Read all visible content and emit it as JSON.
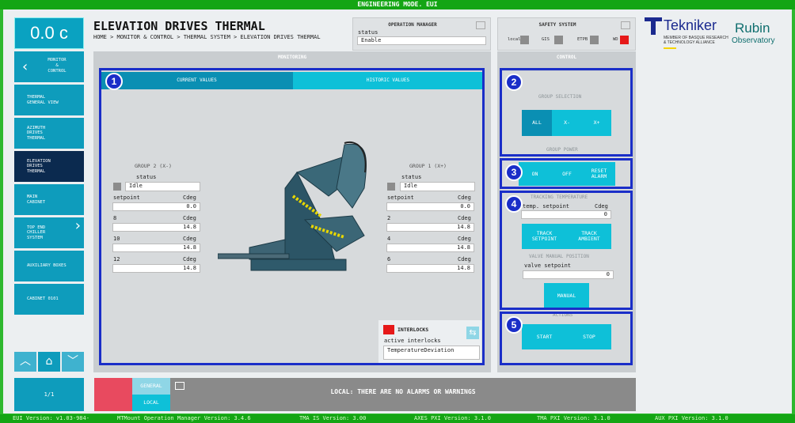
{
  "topbar": {
    "title": "ENGINEERING MODE. EUI"
  },
  "temperature": {
    "value": "0.0 c"
  },
  "nav": {
    "monitor_control": "MONITOR\n&\nCONTROL",
    "items": [
      "THERMAL\nGENERAL VIEW",
      "AZIMUTH\nDRIVES\nTHERMAL",
      "ELEVATION\nDRIVES\nTHERMAL",
      "MAIN\nCABINET",
      "TOP END\nCHILLER\nSYSTEM",
      "AUXILIARY BOXES",
      "CABINET 0101"
    ],
    "page_counter": "1/1"
  },
  "header": {
    "title": "ELEVATION DRIVES THERMAL",
    "breadcrumb": "HOME > MONITOR & CONTROL > THERMAL SYSTEM > ELEVATION DRIVES THERMAL"
  },
  "operation_manager": {
    "title": "OPERATION MANAGER",
    "status_label": "status",
    "status_value": "Enable"
  },
  "safety_system": {
    "title": "SAFETY SYSTEM",
    "indicators": [
      {
        "label": "local",
        "color": "#8c8c8c"
      },
      {
        "label": "GIS",
        "color": "#8c8c8c"
      },
      {
        "label": "ETPB",
        "color": "#8c8c8c"
      },
      {
        "label": "WD",
        "color": "#e61919"
      }
    ]
  },
  "logos": {
    "tekniker": "Tekniker",
    "tekniker_sub": "MEMBER OF BASQUE RESEARCH\n& TECHNOLOGY ALLIANCE",
    "rubin": "Rubin",
    "observatory": "Observatory"
  },
  "monitoring": {
    "title": "MONITORING",
    "tabs": [
      "CURRENT VALUES",
      "HISTORIC VALUES"
    ],
    "group2": {
      "title": "GROUP 2 (X-)",
      "status_label": "status",
      "status_value": "Idle",
      "rows": [
        {
          "label": "setpoint",
          "unit": "Cdeg",
          "value": "0.0"
        },
        {
          "label": "8",
          "unit": "Cdeg",
          "value": "14.8"
        },
        {
          "label": "10",
          "unit": "Cdeg",
          "value": "14.8"
        },
        {
          "label": "12",
          "unit": "Cdeg",
          "value": "14.8"
        }
      ]
    },
    "group1": {
      "title": "GROUP 1 (X+)",
      "status_label": "status",
      "status_value": "Idle",
      "rows": [
        {
          "label": "setpoint",
          "unit": "Cdeg",
          "value": "0.0"
        },
        {
          "label": "2",
          "unit": "Cdeg",
          "value": "14.8"
        },
        {
          "label": "4",
          "unit": "Cdeg",
          "value": "14.8"
        },
        {
          "label": "6",
          "unit": "Cdeg",
          "value": "14.8"
        }
      ]
    },
    "interlocks": {
      "title": "INTERLOCKS",
      "active_label": "active interlocks",
      "value": "TemperatureDeviation"
    }
  },
  "control": {
    "title": "CONTROL",
    "group_selection": {
      "title": "GROUP SELECTION",
      "buttons": [
        "ALL",
        "X-",
        "X+"
      ]
    },
    "group_power": {
      "title": "GROUP POWER",
      "buttons": [
        "ON",
        "OFF",
        "RESET\nALARM"
      ]
    },
    "tracking": {
      "title": "TRACKING TEMPERATURE",
      "setpoint_label": "temp. setpoint",
      "unit": "Cdeg",
      "value": "0",
      "buttons": [
        "TRACK\nSETPOINT",
        "TRACK\nAMBIENT"
      ]
    },
    "valve": {
      "title": "VALVE MANUAL POSITION",
      "label": "valve setpoint",
      "value": "0",
      "button": "MANUAL"
    },
    "actions": {
      "title": "ACTIONS",
      "buttons": [
        "START",
        "STOP"
      ]
    }
  },
  "alarms": {
    "general": "GENERAL",
    "local": "LOCAL",
    "message": "LOCAL: THERE ARE NO ALARMS OR WARNINGS"
  },
  "footer": [
    "EUI Version: v1.03-984-",
    "MTMount Operation Manager Version: 3.4.6",
    "TMA IS Version: 3.00",
    "AXES PXI Version: 3.1.0",
    "TMA PXI Version: 3.1.0",
    "AUX PXI Version: 3.1.0"
  ],
  "badges": [
    "1",
    "2",
    "3",
    "4",
    "5"
  ],
  "colors": {
    "accent": "#0aa2c1",
    "selection_box": "#1a2ec8",
    "alarm": "#e84a5f",
    "interlock": "#e61919"
  }
}
